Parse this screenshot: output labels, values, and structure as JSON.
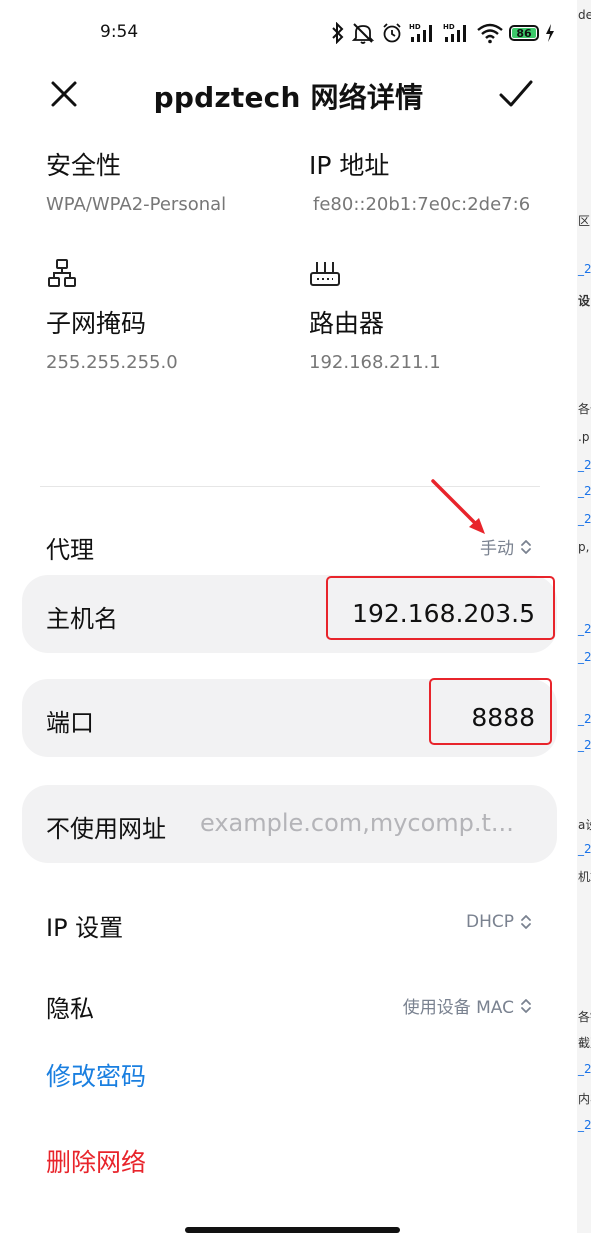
{
  "status_bar": {
    "time": "9:54",
    "battery": "86",
    "icons": [
      "bluetooth-icon",
      "mute-icon",
      "alarm-icon",
      "hd-signal-icon",
      "hd-signal-icon",
      "wifi-icon",
      "battery-icon",
      "charging-icon"
    ]
  },
  "header": {
    "title": "ppdztech 网络详情"
  },
  "info": {
    "security_label": "安全性",
    "security_value": "WPA/WPA2-Personal",
    "ip_label": "IP 地址",
    "ip_value": "fe80::20b1:7e0c:2de7:6",
    "subnet_label": "子网掩码",
    "subnet_value": "255.255.255.0",
    "router_label": "路由器",
    "router_value": "192.168.211.1"
  },
  "proxy": {
    "label": "代理",
    "mode": "手动",
    "hostname_label": "主机名",
    "hostname_value": "192.168.203.5",
    "port_label": "端口",
    "port_value": "8888",
    "bypass_label": "不使用网址",
    "bypass_placeholder": "example.com,mycomp.t..."
  },
  "ip_settings": {
    "label": "IP 设置",
    "value": "DHCP"
  },
  "privacy": {
    "label": "隐私",
    "value": "使用设备 MAC"
  },
  "actions": {
    "change_password": "修改密码",
    "delete_network": "删除网络"
  },
  "colors": {
    "accent_blue": "#1a7fe0",
    "danger_red": "#e8242b",
    "card_bg": "#f2f2f3",
    "annotation_red": "#e8242b"
  },
  "background_app_fragments": [
    "der",
    "区",
    "_2",
    "设",
    "各位",
    ".p",
    "_2",
    "_2",
    "_2",
    "p,",
    "_2",
    "_2",
    "_2",
    "_2",
    "a设",
    "_2",
    "机端",
    "各链",
    "截至",
    "_2",
    "内容",
    "_2"
  ]
}
